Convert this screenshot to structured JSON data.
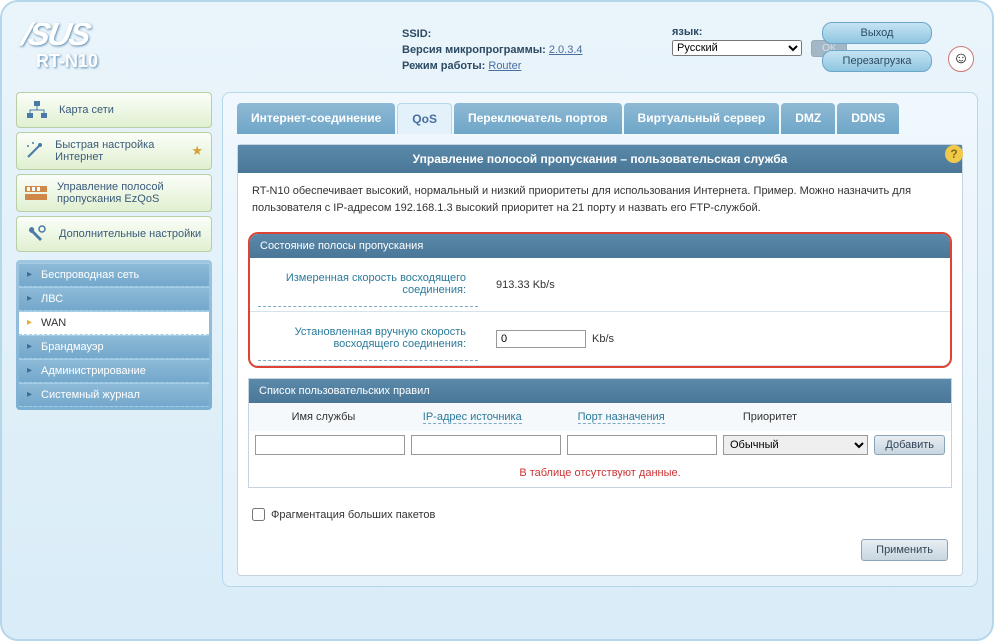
{
  "logo": {
    "brand": "/SUS",
    "model": "RT-N10"
  },
  "header": {
    "ssid_label": "SSID:",
    "firmware_label": "Версия микропрограммы:",
    "firmware_value": "2.0.3.4",
    "mode_label": "Режим работы:",
    "mode_value": "Router",
    "lang_label": "язык:",
    "lang_value": "Русский",
    "ok": "ОК",
    "logout": "Выход",
    "reboot": "Перезагрузка"
  },
  "sidebar": {
    "map": "Карта сети",
    "quick": "Быстрая настройка Интернет",
    "ezqos": "Управление полосой пропускания EzQoS",
    "adv": "Дополнительные настройки",
    "submenu": {
      "wireless": "Беспроводная сеть",
      "lan": "ЛВС",
      "wan": "WAN",
      "firewall": "Брандмауэр",
      "admin": "Администрирование",
      "syslog": "Системный журнал"
    }
  },
  "tabs": {
    "inet": "Интернет-соединение",
    "qos": "QoS",
    "portswitch": "Переключатель портов",
    "vserver": "Виртуальный сервер",
    "dmz": "DMZ",
    "ddns": "DDNS"
  },
  "panel": {
    "title": "Управление полосой пропускания – пользовательская служба",
    "desc": "RT-N10 обеспечивает высокий, нормальный и низкий приоритеты для использования Интернета. Пример. Можно назначить для пользователя с IP-адресом 192.168.1.3 высокий приоритет на 21 порту и назвать его FTP-службой."
  },
  "bandwidth": {
    "section": "Состояние полосы пропускания",
    "measured_label": "Измеренная скорость восходящего соединения:",
    "measured_value": "913.33 Kb/s",
    "manual_label": "Установленная вручную скорость восходящего соединения:",
    "manual_value": "0",
    "unit": "Kb/s"
  },
  "rules": {
    "section": "Список пользовательских правил",
    "col_service": "Имя службы",
    "col_ip": "IP-адрес источника",
    "col_port": "Порт назначения",
    "col_priority": "Приоритет",
    "priority_value": "Обычный",
    "add": "Добавить",
    "nodata": "В таблице отсутствуют данные."
  },
  "frag": "Фрагментация больших пакетов",
  "apply": "Применить"
}
